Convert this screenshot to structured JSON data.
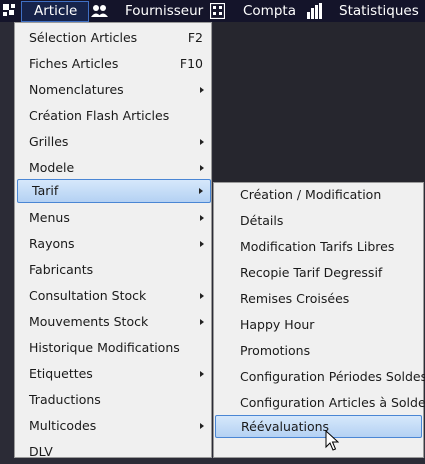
{
  "menubar": {
    "items": [
      {
        "label": "Article",
        "icon": "app-logo-icon"
      },
      {
        "label": "Fournisseur",
        "icon": "people-icon"
      },
      {
        "label": "Compta",
        "icon": "calculator-icon"
      },
      {
        "label": "Statistiques",
        "icon": "bar-chart-icon"
      }
    ]
  },
  "article_menu": {
    "items": [
      {
        "label": "Sélection Articles",
        "shortcut": "F2"
      },
      {
        "label": "Fiches Articles",
        "shortcut": "F10"
      },
      {
        "label": "Nomenclatures",
        "submenu": true
      },
      {
        "label": "Création Flash Articles"
      },
      {
        "label": "Grilles",
        "submenu": true
      },
      {
        "label": "Modele",
        "submenu": true
      },
      {
        "label": "Tarif",
        "submenu": true,
        "selected": true
      },
      {
        "label": "Menus",
        "submenu": true
      },
      {
        "label": "Rayons",
        "submenu": true
      },
      {
        "label": "Fabricants"
      },
      {
        "label": "Consultation Stock",
        "submenu": true
      },
      {
        "label": "Mouvements Stock",
        "submenu": true
      },
      {
        "label": "Historique Modifications"
      },
      {
        "label": "Etiquettes",
        "submenu": true
      },
      {
        "label": "Traductions"
      },
      {
        "label": "Multicodes",
        "submenu": true
      },
      {
        "label": "DLV"
      }
    ]
  },
  "tarif_submenu": {
    "items": [
      {
        "label": "Création / Modification"
      },
      {
        "label": "Détails"
      },
      {
        "label": "Modification Tarifs Libres"
      },
      {
        "label": "Recopie Tarif Degressif"
      },
      {
        "label": "Remises Croisées"
      },
      {
        "label": "Happy Hour"
      },
      {
        "label": "Promotions"
      },
      {
        "label": "Configuration Périodes Soldes"
      },
      {
        "label": "Configuration Articles à Solder"
      },
      {
        "label": "Réévaluations",
        "hovered": true
      }
    ]
  },
  "colors": {
    "menubar_bg": "#14142a",
    "highlight_border": "#4a86d4",
    "menu_bg": "#f0f0f0"
  }
}
